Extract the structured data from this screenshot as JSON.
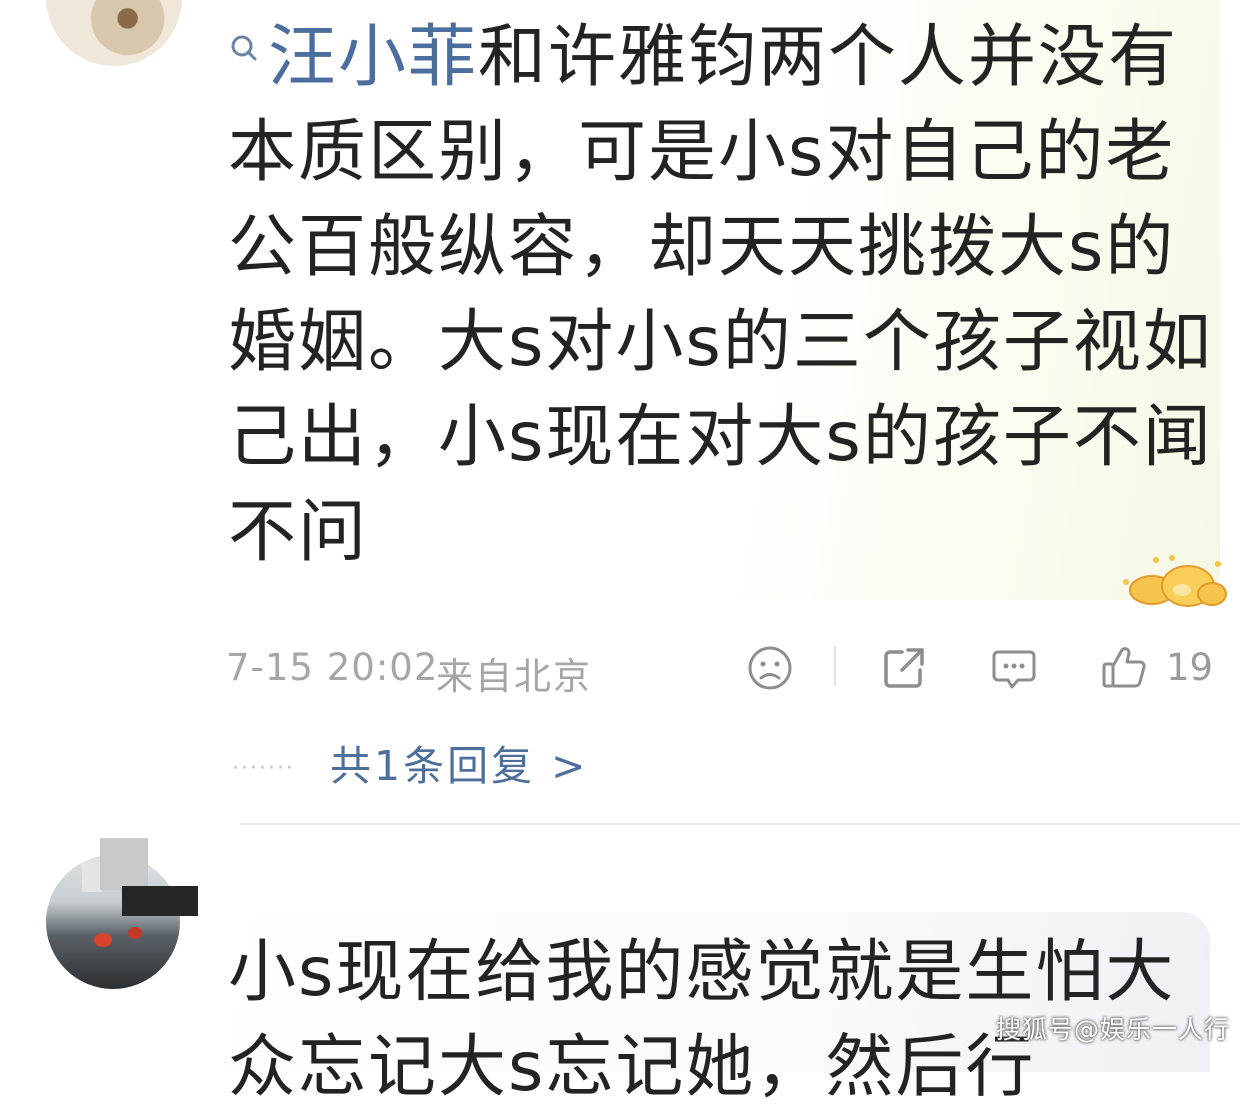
{
  "comments": [
    {
      "mention": "汪小菲",
      "text": "和许雅钧两个人并没有本质区别，可是小s对自己的老公百般纵容，却天天挑拨大s的婚姻。大s对小s的三个孩子视如己出，小s现在对大s的孩子不闻不问",
      "timestamp": "7-15 20:02",
      "location": "来自北京",
      "like_count": "19",
      "replies_link": "共1条回复 >",
      "replies_dots": "·······"
    },
    {
      "text": "小s现在给我的感觉就是生怕大众忘记大s忘记她，然后行"
    }
  ],
  "watermark": "搜狐号@娱乐一人行",
  "icons": {
    "search": "search-icon",
    "dislike": "sad-face-icon",
    "share": "share-icon",
    "reply": "comment-icon",
    "like": "thumbs-up-icon",
    "sticker": "gold-ingot-sticker-icon"
  },
  "colors": {
    "mention": "#4b6e9e",
    "link": "#4e6e9b",
    "meta": "#a6a6a6"
  }
}
